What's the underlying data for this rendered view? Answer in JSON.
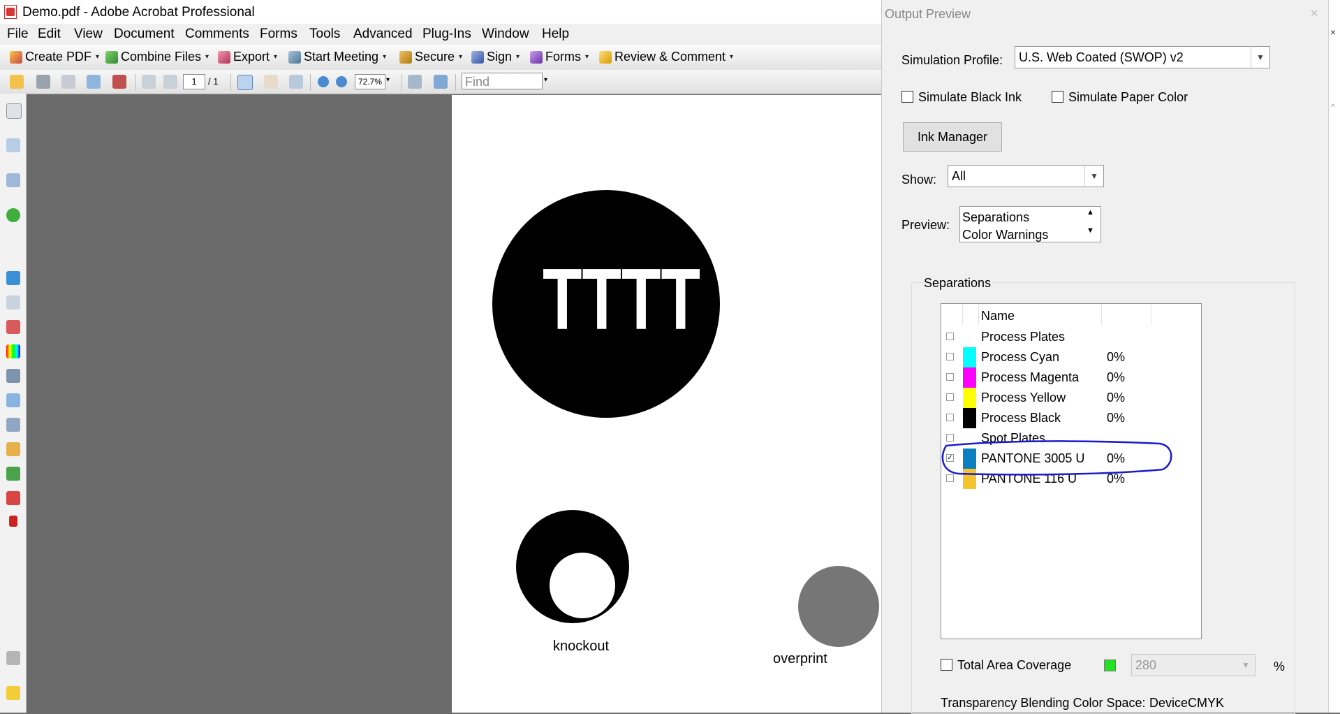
{
  "window": {
    "title": "Demo.pdf - Adobe Acrobat Professional"
  },
  "menu": [
    "File",
    "Edit",
    "View",
    "Document",
    "Comments",
    "Forms",
    "Tools",
    "Advanced",
    "Plug-Ins",
    "Window",
    "Help"
  ],
  "toolbar": {
    "create_pdf": "Create PDF",
    "combine_files": "Combine Files",
    "export": "Export",
    "start_meeting": "Start Meeting",
    "secure": "Secure",
    "sign": "Sign",
    "forms": "Forms",
    "review_comment": "Review & Comment"
  },
  "nav": {
    "page_current": "1",
    "page_total": "/ 1",
    "zoom": "72.7%",
    "find_placeholder": "Find"
  },
  "document": {
    "text_glyphs": "TTTT",
    "knockout_label": "knockout",
    "overprint_label": "overprint"
  },
  "output_preview": {
    "title": "Output Preview",
    "close": "×",
    "simulation_profile_label": "Simulation Profile:",
    "simulation_profile_value": "U.S. Web Coated (SWOP) v2",
    "simulate_black_ink": "Simulate Black Ink",
    "simulate_paper_color": "Simulate Paper Color",
    "ink_manager": "Ink Manager",
    "show_label": "Show:",
    "show_value": "All",
    "preview_label": "Preview:",
    "preview_options": [
      "Separations",
      "Color Warnings"
    ],
    "separations_title": "Separations",
    "column_name": "Name",
    "separations": [
      {
        "name": "Process Plates",
        "percent": "",
        "color": "",
        "checked": false
      },
      {
        "name": "Process Cyan",
        "percent": "0%",
        "color": "#00ffff",
        "checked": false
      },
      {
        "name": "Process Magenta",
        "percent": "0%",
        "color": "#ff00ff",
        "checked": false
      },
      {
        "name": "Process Yellow",
        "percent": "0%",
        "color": "#ffff00",
        "checked": false
      },
      {
        "name": "Process Black",
        "percent": "0%",
        "color": "#000000",
        "checked": false
      },
      {
        "name": "Spot Plates",
        "percent": "",
        "color": "",
        "checked": false
      },
      {
        "name": "PANTONE 3005 U",
        "percent": "0%",
        "color": "#0a7fc2",
        "checked": true
      },
      {
        "name": "PANTONE 116 U",
        "percent": "0%",
        "color": "#f5c42c",
        "checked": false
      }
    ],
    "total_area_coverage": "Total Area Coverage",
    "coverage_value": "280",
    "coverage_unit": "%",
    "coverage_color": "#22e022",
    "transparency_label": "Transparency Blending Color Space:",
    "transparency_value": "DeviceCMYK",
    "annotation_color": "#1a1acc"
  }
}
